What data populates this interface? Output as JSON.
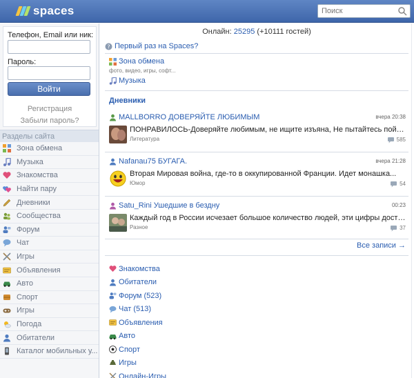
{
  "header": {
    "logo_text": "spaces",
    "search_placeholder": "Поиск"
  },
  "login": {
    "phone_label": "Телефон, Email или ник:",
    "password_label": "Пароль:",
    "login_button": "Войти",
    "register_link": "Регистрация",
    "forgot_link": "Забыли пароль?"
  },
  "sidebar": {
    "title": "Разделы сайта",
    "items": [
      {
        "label": "Зона обмена",
        "icon": "grid-icon",
        "color": "#f0a030"
      },
      {
        "label": "Музыка",
        "icon": "music-note-icon",
        "color": "#6a7fc0"
      },
      {
        "label": "Знакомства",
        "icon": "heart-icon",
        "color": "#e0507a"
      },
      {
        "label": "Найти пару",
        "icon": "hearts-icon",
        "color": "#e05090"
      },
      {
        "label": "Дневники",
        "icon": "pencil-icon",
        "color": "#c9a040"
      },
      {
        "label": "Сообщества",
        "icon": "community-icon",
        "color": "#7a9c3a"
      },
      {
        "label": "Форум",
        "icon": "forum-icon",
        "color": "#4f7cc0"
      },
      {
        "label": "Чат",
        "icon": "chat-bubble-icon",
        "color": "#7aa6d8"
      },
      {
        "label": "Игры",
        "icon": "swords-icon",
        "color": "#a08050"
      },
      {
        "label": "Объявления",
        "icon": "ads-icon",
        "color": "#d8a020"
      },
      {
        "label": "Авто",
        "icon": "car-icon",
        "color": "#3a8a4a"
      },
      {
        "label": "Спорт",
        "icon": "ball-icon",
        "color": "#c07020"
      },
      {
        "label": "Игры",
        "icon": "gamepad-icon",
        "color": "#8a6a40"
      },
      {
        "label": "Погода",
        "icon": "weather-icon",
        "color": "#e0a020"
      },
      {
        "label": "Обитатели",
        "icon": "user-icon",
        "color": "#4f7cc0"
      },
      {
        "label": "Каталог мобильных у...",
        "icon": "phone-icon",
        "color": "#555555"
      }
    ]
  },
  "main": {
    "online_prefix": "Онлайн:",
    "online_count": "25295",
    "online_guests": "(+10111 гостей)",
    "first_time": "Первый раз на Spaces?",
    "exchange": {
      "label": "Зона обмена",
      "sub": "фото, видео, игры, софт..."
    },
    "music": {
      "label": "Музыка"
    },
    "diaries_title": "Дневники",
    "entries": [
      {
        "author": "MALLBORRO",
        "title": "ДОВЕРЯЙТЕ ЛЮБИМЫМ",
        "time": "вчера 20:38",
        "text": "ПОНРАВИЛОСЬ-Доверяйте любимым, не ищите изъяна, Не пытайтесь поймат...",
        "category": "Литература",
        "comments": "585"
      },
      {
        "author": "Nafanau75",
        "title": "БУГАГА.",
        "time": "вчера 21:28",
        "text": "Вторая Мировая война, где-то в оккупированной Франции. Идет монашка...",
        "category": "Юмор",
        "comments": "54"
      },
      {
        "author": "Satu_Rini",
        "title": "Ушедшие в бездну",
        "time": "00:23",
        "text": "Каждый год в России исчезает большое количество людей, эти цифры достига...",
        "category": "Разное",
        "comments": "37"
      }
    ],
    "all_notes": "Все записи →",
    "bottom_links": [
      {
        "label": "Знакомства",
        "icon": "heart-icon",
        "color": "#e0507a"
      },
      {
        "label": "Обитатели",
        "icon": "user-icon",
        "color": "#4f7cc0"
      },
      {
        "label": "Форум (523)",
        "icon": "forum-icon",
        "color": "#4f7cc0"
      },
      {
        "label": "Чат (513)",
        "icon": "chat-bubble-icon",
        "color": "#7aa6d8"
      },
      {
        "label": "Объявления",
        "icon": "ads-icon",
        "color": "#d8a020"
      },
      {
        "label": "Авто",
        "icon": "car-icon",
        "color": "#3a8a4a"
      },
      {
        "label": "Спорт",
        "icon": "ball-icon",
        "color": "#222222"
      },
      {
        "label": "Игры",
        "icon": "gamepad-icon",
        "color": "#5a6a3a"
      },
      {
        "label": "Онлайн-Игры",
        "icon": "swords-icon",
        "color": "#a08050"
      }
    ]
  }
}
